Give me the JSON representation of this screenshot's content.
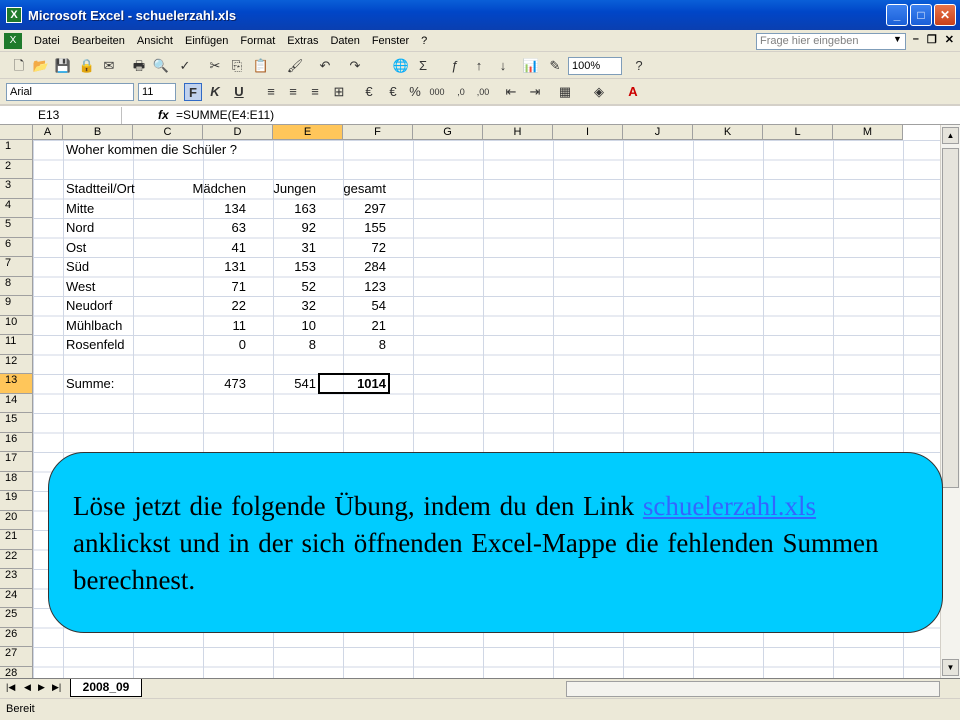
{
  "window": {
    "title": "Microsoft Excel - schuelerzahl.xls",
    "minimize_icon": "minimize-icon",
    "maximize_icon": "maximize-icon",
    "close_icon": "close-icon"
  },
  "menu": {
    "items": [
      "Datei",
      "Bearbeiten",
      "Ansicht",
      "Einfügen",
      "Format",
      "Extras",
      "Daten",
      "Fenster",
      "?"
    ],
    "help_placeholder": "Frage hier eingeben"
  },
  "toolbar": {
    "zoom": "100%",
    "font_name": "Arial",
    "font_size": "11",
    "bold_label": "F",
    "italic_label": "K",
    "underline_label": "U"
  },
  "formula_bar": {
    "cell_ref": "E13",
    "formula": "=SUMME(E4:E11)"
  },
  "columns": [
    "A",
    "B",
    "C",
    "D",
    "E",
    "F",
    "G",
    "H",
    "I",
    "J",
    "K",
    "L",
    "M"
  ],
  "rows": [
    "1",
    "2",
    "3",
    "4",
    "5",
    "6",
    "7",
    "8",
    "9",
    "10",
    "11",
    "12",
    "13",
    "14",
    "15",
    "16",
    "17",
    "18",
    "19",
    "20",
    "21",
    "22",
    "23",
    "24",
    "25",
    "26",
    "27",
    "28"
  ],
  "sheet": {
    "title": "Woher kommen die Schüler ?",
    "headers": [
      "Stadtteil/Ort",
      "Mädchen",
      "Jungen",
      "gesamt"
    ],
    "data": [
      [
        "Mitte",
        "134",
        "163",
        "297"
      ],
      [
        "Nord",
        "63",
        "92",
        "155"
      ],
      [
        "Ost",
        "41",
        "31",
        "72"
      ],
      [
        "Süd",
        "131",
        "153",
        "284"
      ],
      [
        "West",
        "71",
        "52",
        "123"
      ],
      [
        "Neudorf",
        "22",
        "32",
        "54"
      ],
      [
        "Mühlbach",
        "11",
        "10",
        "21"
      ],
      [
        "Rosenfeld",
        "0",
        "8",
        "8"
      ]
    ],
    "sum_label": "Summe:",
    "sum_values": [
      "473",
      "541",
      "1014"
    ]
  },
  "tabs": {
    "active": "2008_09"
  },
  "status": "Bereit",
  "callout": {
    "text_before": "Löse jetzt die folgende Übung, indem du den Link ",
    "link": "schuelerzahl.xls ",
    "text_after": "anklickst und in der sich öffnenden Excel-Mappe die fehlenden Summen berechnest."
  }
}
